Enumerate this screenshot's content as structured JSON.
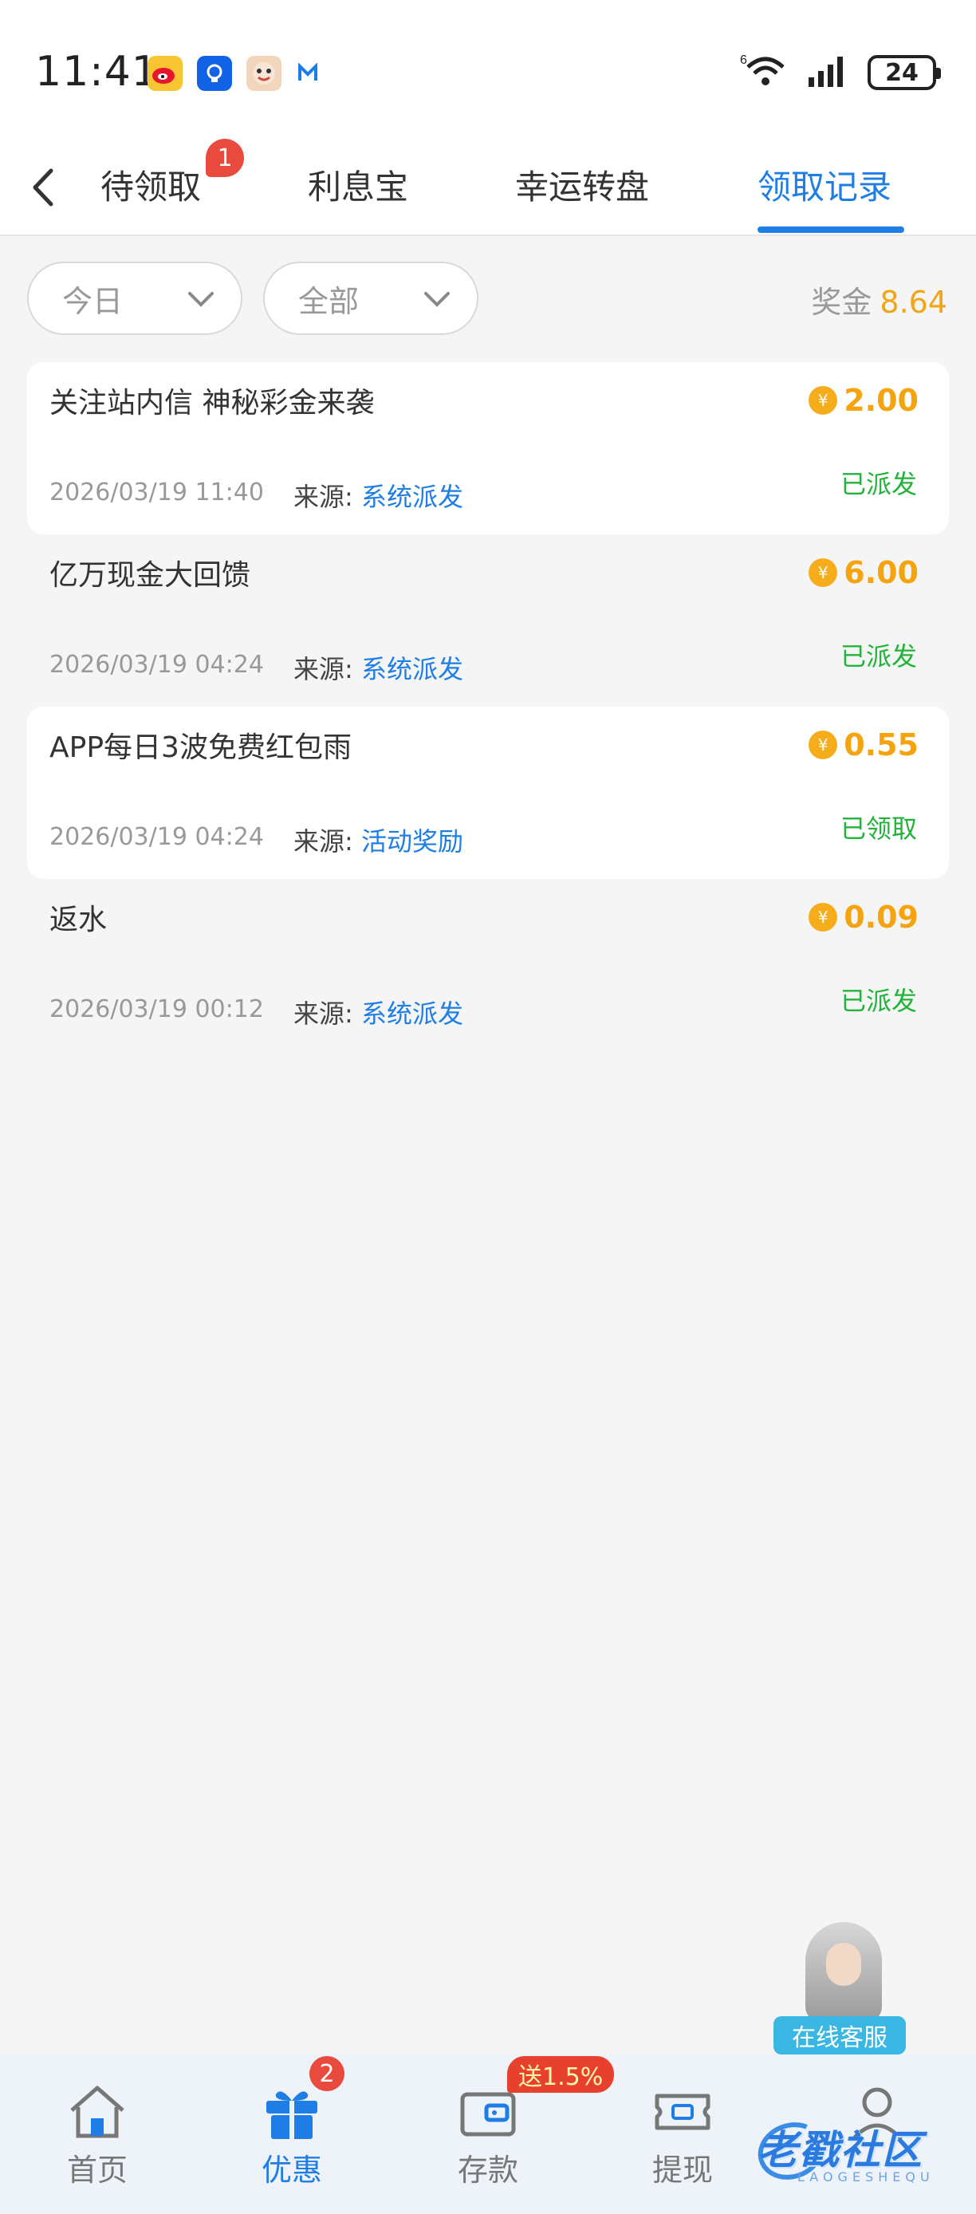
{
  "status_bar": {
    "time": "11:41",
    "battery": "24",
    "wifi_sup": "6"
  },
  "tabs": [
    {
      "label": "待领取",
      "badge": "1",
      "active": false
    },
    {
      "label": "利息宝",
      "active": false
    },
    {
      "label": "幸运转盘",
      "active": false
    },
    {
      "label": "领取记录",
      "active": true
    }
  ],
  "filters": {
    "date": "今日",
    "type": "全部"
  },
  "bonus": {
    "label": "奖金",
    "value": "8.64"
  },
  "records": [
    {
      "title": "关注站内信 神秘彩金来袭",
      "amount": "2.00",
      "datetime": "2026/03/19 11:40",
      "source_label": "来源:",
      "source": "系统派发",
      "status": "已派发"
    },
    {
      "title": "亿万现金大回馈",
      "amount": "6.00",
      "datetime": "2026/03/19 04:24",
      "source_label": "来源:",
      "source": "系统派发",
      "status": "已派发"
    },
    {
      "title": "APP每日3波免费红包雨",
      "amount": "0.55",
      "datetime": "2026/03/19 04:24",
      "source_label": "来源:",
      "source": "活动奖励",
      "status": "已领取"
    },
    {
      "title": "返水",
      "amount": "0.09",
      "datetime": "2026/03/19 00:12",
      "source_label": "来源:",
      "source": "系统派发",
      "status": "已派发"
    }
  ],
  "coin_symbol": "¥",
  "customer_service": {
    "label": "在线客服"
  },
  "bottom_nav": [
    {
      "label": "首页",
      "icon": "home-icon"
    },
    {
      "label": "优惠",
      "icon": "gift-icon",
      "badge": "2",
      "active": true
    },
    {
      "label": "存款",
      "icon": "wallet-icon",
      "promo": "送1.5%"
    },
    {
      "label": "提现",
      "icon": "ticket-icon"
    },
    {
      "label": "",
      "icon": "user-icon"
    }
  ],
  "watermark": {
    "text": "老戳社区",
    "sub": "LAOGESHEQU"
  },
  "colors": {
    "accent": "#1e7ee6",
    "amount": "#f5a40f",
    "status_green": "#22b33a",
    "badge_red": "#e84a3d"
  }
}
